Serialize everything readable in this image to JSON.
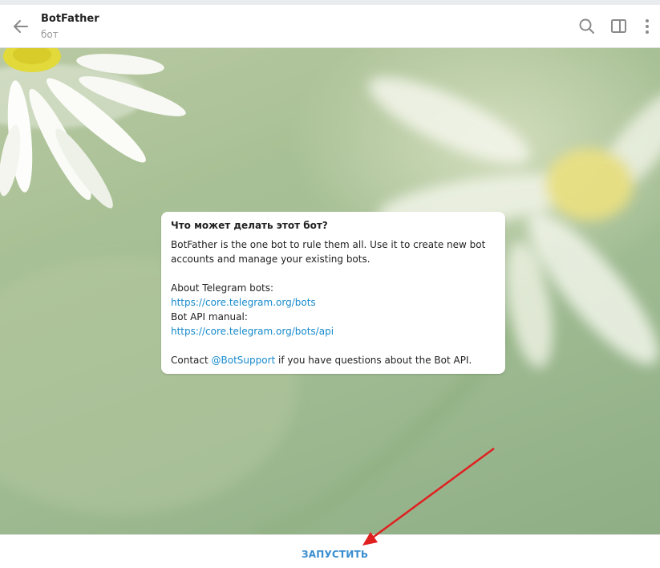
{
  "header": {
    "title": "BotFather",
    "subtitle": "бот",
    "icons": [
      "back-arrow-icon",
      "search-icon",
      "side-panel-icon",
      "more-vertical-icon"
    ]
  },
  "bubble": {
    "title": "Что может делать этот бот?",
    "intro_line1": "BotFather is the one bot to rule them all. Use it to create new bot",
    "intro_line2": "accounts and manage your existing bots.",
    "about_label": "About Telegram bots:",
    "about_link": "https://core.telegram.org/bots",
    "manual_label": "Bot API manual:",
    "manual_link": "https://core.telegram.org/bots/api",
    "contact_prefix": "Contact ",
    "contact_handle": "@BotSupport",
    "contact_suffix": " if you have questions about the Bot API."
  },
  "footer": {
    "start_label": "ЗАПУСТИТЬ"
  },
  "colors": {
    "accent": "#168acd",
    "start": "#3a8ed0",
    "annotation_arrow": "#e02020"
  }
}
